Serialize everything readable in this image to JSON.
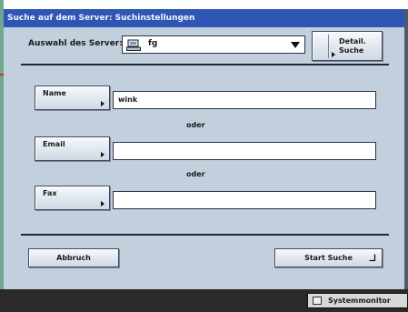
{
  "window": {
    "title": "Suche auf dem Server: Suchinstellungen"
  },
  "server": {
    "label": "Auswahl des Server:",
    "selected_value": "fg",
    "icon": "computer-icon"
  },
  "detail_button": {
    "line1": "Detail.",
    "line2": "Suche"
  },
  "fields": [
    {
      "button_label": "Name",
      "value": "wink"
    },
    {
      "button_label": "Email",
      "value": ""
    },
    {
      "button_label": "Fax",
      "value": ""
    }
  ],
  "separators": [
    "oder",
    "oder"
  ],
  "footer": {
    "cancel_label": "Abbruch",
    "start_label": "Start Suche"
  },
  "statusbar": {
    "monitor_label": "Systemmonitor"
  },
  "colors": {
    "title_bar": "#2f56b4",
    "panel": "#c2cfdd",
    "accent_green": "#6ea893",
    "status_bar": "#2a2a2a"
  }
}
